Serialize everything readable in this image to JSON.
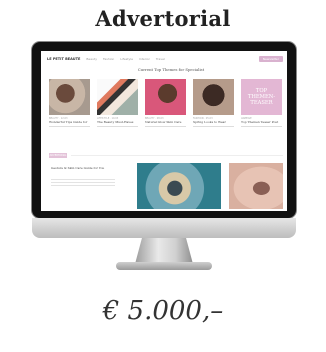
{
  "heading": "Advertorial",
  "price": "€ 5.000,–",
  "screen": {
    "logo": "LE PETIT BEAUTE",
    "nav_items": [
      "Beauty",
      "Fashion",
      "Lifestyle",
      "Interior",
      "Travel"
    ],
    "newsletter_label": "Newsletter",
    "hero_title": "Current Top Themes for Specialist",
    "teaser_lines": [
      "TOP",
      "THEMEN-",
      "TEASER"
    ],
    "cards": [
      {
        "meta": "BEAUTY · 12.03",
        "head": "Wonderful Tips Guide for"
      },
      {
        "meta": "LIFESTYLE · 10.03",
        "head": "The Beauty Must-Haves"
      },
      {
        "meta": "BEAUTY · 08.03",
        "head": "Natural Glow Skin Care"
      },
      {
        "meta": "FASHION · 05.03",
        "head": "Spring Looks to Wear"
      },
      {
        "meta": "ANZEIGE",
        "head": "Top Themen Teaser Post"
      }
    ],
    "section_label": "ADVERTORIAL",
    "feature_title": "Gesture & Skin Care Guide for You"
  }
}
